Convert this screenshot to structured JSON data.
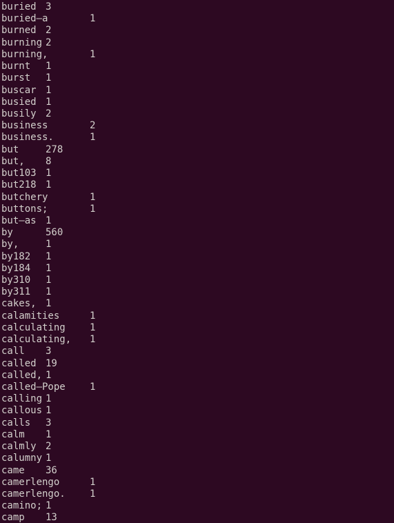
{
  "window": {
    "app": "terminal",
    "title": "Terminal",
    "background_color": "#2D0922",
    "foreground_color": "#D3D0CC",
    "columns": 71,
    "rows": 44,
    "tab_width": 8,
    "char_width": 8.0,
    "line_height": 17.23
  },
  "listing": {
    "description": "word frequency listing, word followed by tab-aligned count",
    "columns": [
      "word",
      "count"
    ],
    "rows": [
      {
        "word": "buried",
        "count": "3"
      },
      {
        "word": "buried–a",
        "count": "1"
      },
      {
        "word": "burned",
        "count": "2"
      },
      {
        "word": "burning",
        "count": "2"
      },
      {
        "word": "burning,",
        "count": "1"
      },
      {
        "word": "burnt",
        "count": "1"
      },
      {
        "word": "burst",
        "count": "1"
      },
      {
        "word": "buscar",
        "count": "1"
      },
      {
        "word": "busied",
        "count": "1"
      },
      {
        "word": "busily",
        "count": "2"
      },
      {
        "word": "business",
        "count": "2"
      },
      {
        "word": "business.",
        "count": "1"
      },
      {
        "word": "but",
        "count": "278"
      },
      {
        "word": "but,",
        "count": "8"
      },
      {
        "word": "but103",
        "count": "1"
      },
      {
        "word": "but218",
        "count": "1"
      },
      {
        "word": "butchery",
        "count": "1"
      },
      {
        "word": "buttons;",
        "count": "1"
      },
      {
        "word": "but–as",
        "count": "1"
      },
      {
        "word": "by",
        "count": "560"
      },
      {
        "word": "by,",
        "count": "1"
      },
      {
        "word": "by182",
        "count": "1"
      },
      {
        "word": "by184",
        "count": "1"
      },
      {
        "word": "by310",
        "count": "1"
      },
      {
        "word": "by311",
        "count": "1"
      },
      {
        "word": "cakes,",
        "count": "1"
      },
      {
        "word": "calamities",
        "count": "1"
      },
      {
        "word": "calculating",
        "count": "1"
      },
      {
        "word": "calculating,",
        "count": "1"
      },
      {
        "word": "call",
        "count": "3"
      },
      {
        "word": "called",
        "count": "19"
      },
      {
        "word": "called,",
        "count": "1"
      },
      {
        "word": "called–Pope",
        "count": "1"
      },
      {
        "word": "calling",
        "count": "1"
      },
      {
        "word": "callous",
        "count": "1"
      },
      {
        "word": "calls",
        "count": "3"
      },
      {
        "word": "calm",
        "count": "1"
      },
      {
        "word": "calmly",
        "count": "2"
      },
      {
        "word": "calumny",
        "count": "1"
      },
      {
        "word": "came",
        "count": "36"
      },
      {
        "word": "camerlengo",
        "count": "1"
      },
      {
        "word": "camerlengo.",
        "count": "1"
      },
      {
        "word": "camino;",
        "count": "1"
      },
      {
        "word": "camp",
        "count": "13"
      }
    ]
  }
}
